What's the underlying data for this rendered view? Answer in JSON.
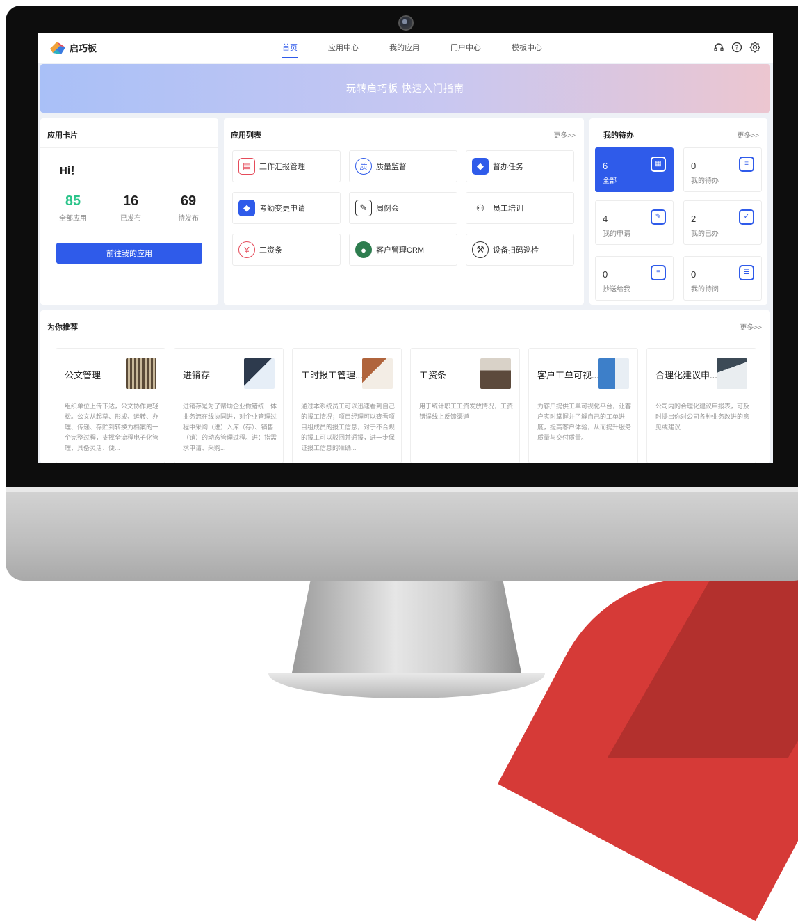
{
  "nav": {
    "logo_text": "启巧板",
    "items": [
      {
        "label": "首页",
        "active": true
      },
      {
        "label": "应用中心"
      },
      {
        "label": "我的应用"
      },
      {
        "label": "门户中心"
      },
      {
        "label": "模板中心"
      }
    ],
    "icons": [
      "headset-icon",
      "help-icon",
      "settings-icon"
    ]
  },
  "banner": {
    "text": "玩转启巧板  快速入门指南"
  },
  "app_card": {
    "title": "应用卡片",
    "greeting": "Hi！",
    "stats": [
      {
        "value": "85",
        "label": "全部应用"
      },
      {
        "value": "16",
        "label": "已发布"
      },
      {
        "value": "69",
        "label": "待发布"
      }
    ],
    "button": "前往我的应用"
  },
  "app_list": {
    "title": "应用列表",
    "more": "更多>>",
    "apps": [
      {
        "label": "工作汇报管理",
        "icon": "chat-report-icon",
        "color": "#e54b5a"
      },
      {
        "label": "质量监督",
        "icon": "quality-icon",
        "color": "#2f5bea"
      },
      {
        "label": "督办任务",
        "icon": "cube-icon",
        "color": "#2f5bea"
      },
      {
        "label": "考勤变更申请",
        "icon": "cube-icon",
        "color": "#2f5bea"
      },
      {
        "label": "周例会",
        "icon": "edit-icon",
        "color": "#333333"
      },
      {
        "label": "员工培训",
        "icon": "training-icon",
        "color": "#333333"
      },
      {
        "label": "工资条",
        "icon": "yen-icon",
        "color": "#e54b5a"
      },
      {
        "label": "客户管理CRM",
        "icon": "person-icon",
        "color": "#2e7d4f"
      },
      {
        "label": "设备扫码巡检",
        "icon": "wrench-icon",
        "color": "#333333"
      }
    ]
  },
  "todo": {
    "title": "我的待办",
    "more": "更多>>",
    "tiles": [
      {
        "num": "6",
        "label": "全部",
        "icon": "grid-icon",
        "glyph": "▦"
      },
      {
        "num": "0",
        "label": "我的待办",
        "icon": "clock-list-icon",
        "glyph": "≡"
      },
      {
        "num": "4",
        "label": "我的申请",
        "icon": "edit-list-icon",
        "glyph": "✎"
      },
      {
        "num": "2",
        "label": "我的已办",
        "icon": "calendar-check-icon",
        "glyph": "✓"
      },
      {
        "num": "0",
        "label": "抄送给我",
        "icon": "clock-list-icon",
        "glyph": "≡"
      },
      {
        "num": "0",
        "label": "我的待阅",
        "icon": "stack-icon",
        "glyph": "☰"
      }
    ]
  },
  "recommend": {
    "title": "为你推荐",
    "more": "更多>>",
    "items": [
      {
        "title": "公文管理",
        "desc": "组织单位上传下达，公文协作更轻松。公文从起草、形成、运转、办理、传递、存贮到转换为档案的一个完整过程，支撑全流程电子化管理，具备灵活、便...",
        "img_color": "#8a7a62"
      },
      {
        "title": "进销存",
        "desc": "进销存是为了帮助企业做错统一体业务流在线协同进，对企业管理过程中采购（进）入库（存）、销售（销）的动态管理过程。进：指需求申请、采购...",
        "img_color": "#4a6fa5"
      },
      {
        "title": "工时报工管理...",
        "desc": "通过本系统员工可以迅速看到自己的报工情况；项目经理可以查看项目组成员的报工信息，对于不合规的报工可以驳回并通报，进一步保证报工信息的准确...",
        "img_color": "#b0643c"
      },
      {
        "title": "工资条",
        "desc": "用于统计职工工资发放情况，工资错误线上反馈渠道",
        "img_color": "#6b5a4c"
      },
      {
        "title": "客户工单可视...",
        "desc": "为客户提供工单可视化平台，让客户实时掌握并了解自己的工单进度，提高客户体验，从而提升服务质量与交付质量。",
        "img_color": "#3d7fc9"
      },
      {
        "title": "合理化建议申...",
        "desc": "公司内的合理化建议申报表，可及时提出你对公司各种业务改进的意见或建议",
        "img_color": "#7a8590"
      }
    ]
  }
}
